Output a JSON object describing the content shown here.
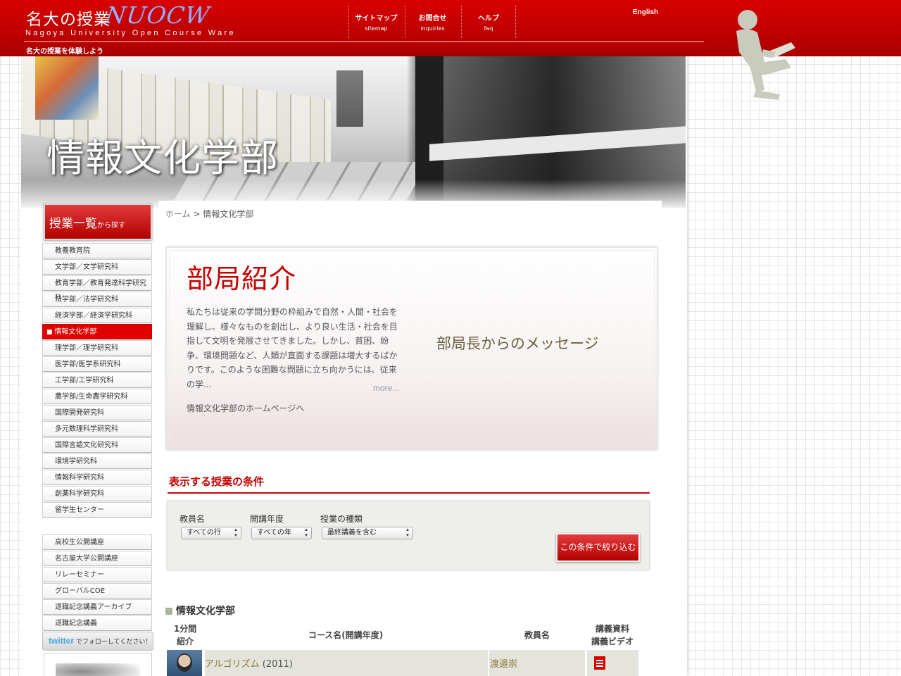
{
  "header": {
    "logo_jp": "名大の授業",
    "logo_script": "NUOCW",
    "logo_en": "Nagoya University Open Course Ware",
    "tagline": "名大の授業を体験しよう",
    "nav": [
      {
        "jp": "サイトマップ",
        "en": "sitemap"
      },
      {
        "jp": "お問合せ",
        "en": "inquiries"
      },
      {
        "jp": "ヘルプ",
        "en": "faq"
      }
    ],
    "english_link": "English"
  },
  "hero": {
    "title": "情報文化学部"
  },
  "sidebar": {
    "browse_button": {
      "big": "授業一覧",
      "small": "から探す"
    },
    "departments": [
      "教養教育院",
      "文学部／文学研究科",
      "教育学部／教育発達科学研究科",
      "法学部／法学研究科",
      "経済学部／経済学研究科",
      "情報文化学部",
      "理学部／理学研究科",
      "医学部/医学系研究科",
      "工学部/工学研究科",
      "農学部/生命農学研究科",
      "国際開発研究科",
      "多元数理科学研究科",
      "国際言語文化研究科",
      "環境学研究科",
      "情報科学研究科",
      "創薬科学研究科",
      "留学生センター"
    ],
    "active_department": "情報文化学部",
    "extras": [
      "高校生公開講座",
      "名古屋大学公開講座",
      "リレーセミナー",
      "グローバルCOE",
      "退職記念講義アーカイブ",
      "退職記念講義"
    ],
    "twitter": {
      "brand": "twitter",
      "label": "でフォローしてください！"
    }
  },
  "breadcrumb": {
    "home": "ホーム",
    "separator": " > ",
    "current": "情報文化学部"
  },
  "intro": {
    "title": "部局紹介",
    "text": "私たちは従来の学問分野の枠組みで自然・人間・社会を理解し、様々なものを創出し、より良い生活・社会を目指して文明を発展させてきました。しかし、貧困、紛争、環境問題など、人類が直面する課題は増大するばかりです。このような困難な問題に立ち向かうには、従来の学...",
    "more": "more...",
    "home_link": "情報文化学部のホームページへ",
    "message_link": "部局長からのメッセージ"
  },
  "filter": {
    "heading": "表示する授業の条件",
    "fields": [
      {
        "label": "教員名",
        "value": "すべての行"
      },
      {
        "label": "開講年度",
        "value": "すべての年"
      },
      {
        "label": "授業の種類",
        "value": "最終講義を含む"
      }
    ],
    "submit": "この条件で絞り込む"
  },
  "results": {
    "heading": "情報文化学部",
    "columns": {
      "intro_line1": "1分間",
      "intro_line2": "紹介",
      "course": "コース名(開講年度)",
      "instructor": "教員名",
      "materials_line1": "講義資料",
      "materials_line2": "講義ビデオ"
    },
    "rows": [
      {
        "course": "アルゴリズム",
        "year": " (2011)",
        "instructor": "渡邉崇"
      }
    ]
  },
  "colors": {
    "brand_red": "#c80000",
    "link_olive": "#8a7a3a"
  }
}
